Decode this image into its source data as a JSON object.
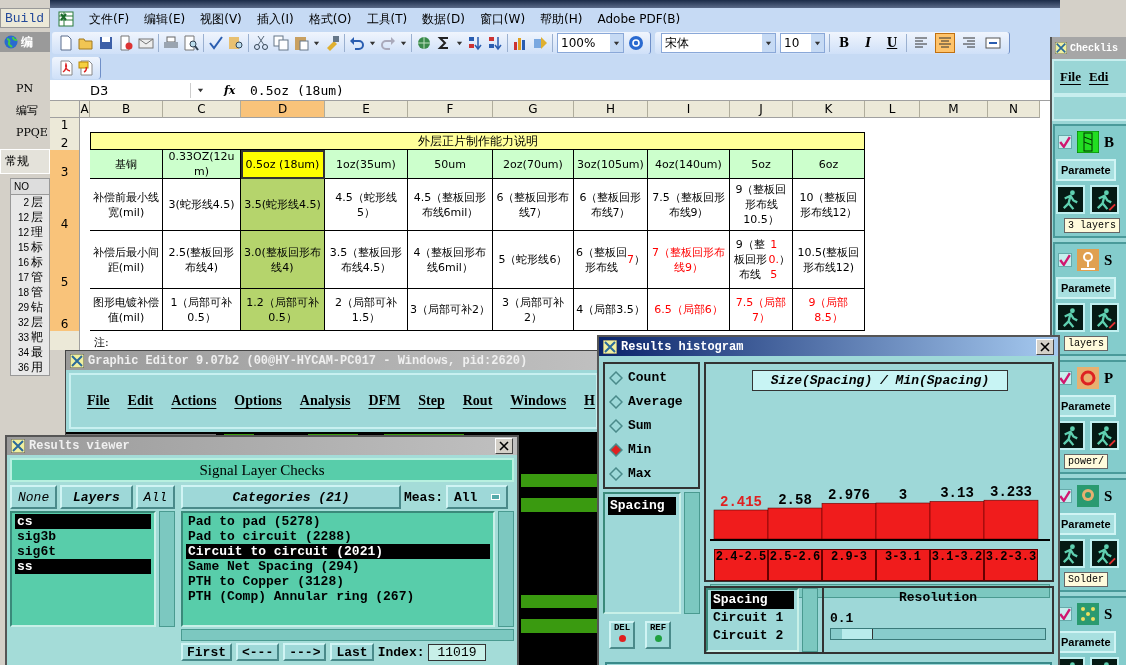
{
  "build_panel": {
    "top_button": "Build",
    "app_label": "编",
    "fields": [
      "PN",
      "编写",
      "PPQE"
    ],
    "tab": "常规",
    "list_header": "NO",
    "rows": [
      {
        "no": "2",
        "name": "层"
      },
      {
        "no": "12",
        "name": "层"
      },
      {
        "no": "12",
        "name": "理"
      },
      {
        "no": "15",
        "name": "标"
      },
      {
        "no": "16",
        "name": "标"
      },
      {
        "no": "17",
        "name": "管"
      },
      {
        "no": "18",
        "name": "管"
      },
      {
        "no": "29",
        "name": "钻"
      },
      {
        "no": "32",
        "name": "层"
      },
      {
        "no": "33",
        "name": "靶"
      },
      {
        "no": "34",
        "name": "最"
      },
      {
        "no": "36",
        "name": "用"
      }
    ]
  },
  "excel": {
    "menu": [
      "文件(F)",
      "编辑(E)",
      "视图(V)",
      "插入(I)",
      "格式(O)",
      "工具(T)",
      "数据(D)",
      "窗口(W)",
      "帮助(H)",
      "Adobe PDF(B)"
    ],
    "zoom": "100%",
    "font": "宋体",
    "font_size": "10",
    "format_buttons": [
      {
        "label": "B",
        "selected": false
      },
      {
        "label": "I",
        "selected": false
      },
      {
        "label": "U",
        "selected": false
      }
    ],
    "align_buttons": [
      {
        "selected": false
      },
      {
        "selected": true
      },
      {
        "selected": false
      },
      {
        "selected": false
      }
    ],
    "name_box": "D3",
    "fx_label": "fx",
    "formula": "0.5oz (18um)",
    "columns": [
      {
        "label": "A",
        "selected": false
      },
      {
        "label": "B",
        "selected": false
      },
      {
        "label": "C",
        "selected": false
      },
      {
        "label": "D",
        "selected": true
      },
      {
        "label": "E",
        "selected": false
      },
      {
        "label": "F",
        "selected": false
      },
      {
        "label": "G",
        "selected": false
      },
      {
        "label": "H",
        "selected": false
      },
      {
        "label": "I",
        "selected": false
      },
      {
        "label": "J",
        "selected": false
      },
      {
        "label": "K",
        "selected": false
      },
      {
        "label": "L",
        "selected": false
      },
      {
        "label": "M",
        "selected": false
      },
      {
        "label": "N",
        "selected": false
      }
    ],
    "rows": [
      {
        "label": "1",
        "selected": false
      },
      {
        "label": "2",
        "selected": false
      },
      {
        "label": "3",
        "selected": true
      },
      {
        "label": "4",
        "selected": true
      },
      {
        "label": "5",
        "selected": true
      },
      {
        "label": "6",
        "selected": true
      }
    ],
    "table_title": "外层正片制作能力说明",
    "table_rows": [
      [
        {
          "text": "基铜",
          "kind": "header",
          "red": false
        },
        {
          "text": "0.33OZ(12um)",
          "kind": "header",
          "red": false
        },
        {
          "text": "0.5oz (18um)",
          "kind": "mark",
          "red": false
        },
        {
          "text": "1oz(35um)",
          "kind": "header",
          "red": false
        },
        {
          "text": "50um",
          "kind": "header",
          "red": false
        },
        {
          "text": "2oz(70um)",
          "kind": "header",
          "red": false
        },
        {
          "text": "3oz(105um)",
          "kind": "header",
          "red": false
        },
        {
          "text": "4oz(140um)",
          "kind": "header",
          "red": false
        },
        {
          "text": "5oz",
          "kind": "header",
          "red": false
        },
        {
          "text": "6oz",
          "kind": "header",
          "red": false
        }
      ],
      [
        {
          "text": "补偿前最小线宽(mil)",
          "kind": "body",
          "red": false
        },
        {
          "text": "3(蛇形线4.5)",
          "kind": "body",
          "red": false
        },
        {
          "text": "3.5(蛇形线4.5)",
          "kind": "body",
          "red": false
        },
        {
          "text": "4.5（蛇形线5）",
          "kind": "body",
          "red": false
        },
        {
          "text": "4.5（整板回形布线6mil）",
          "kind": "body",
          "red": false
        },
        {
          "text": "6（整板回形布线7）",
          "kind": "body",
          "red": false
        },
        {
          "text": "6（整板回形布线7）",
          "kind": "body",
          "red": false
        },
        {
          "text": "7.5（整板回形布线9）",
          "kind": "body",
          "red": false
        },
        {
          "text": "9（整板回形布线10.5）",
          "kind": "body",
          "red": false
        },
        {
          "text": "10（整板回形布线12）",
          "kind": "body",
          "red": false
        }
      ],
      [
        {
          "text": "补偿后最小间距(mil)",
          "kind": "body",
          "red": false
        },
        {
          "text": "2.5(整板回形布线4)",
          "kind": "body",
          "red": false
        },
        {
          "text": "3.0(整板回形布线4)",
          "kind": "body",
          "red": false
        },
        {
          "text": "3.5（整板回形布线4.5）",
          "kind": "body",
          "red": false
        },
        {
          "text": "4（整板回形布线6mil）",
          "kind": "body",
          "red": false
        },
        {
          "text": "5（蛇形线6）",
          "kind": "body",
          "red": false
        },
        {
          "kind": "body",
          "parts": [
            {
              "text": "6（整板回形布线",
              "red": false
            },
            {
              "text": "7",
              "red": true
            },
            {
              "text": "）",
              "red": false
            }
          ]
        },
        {
          "text": "7（整板回形布线9）",
          "kind": "body",
          "red": true
        },
        {
          "kind": "body",
          "parts": [
            {
              "text": "9（整板回形布线",
              "red": false
            },
            {
              "text": "10.5",
              "red": true
            },
            {
              "text": "）",
              "red": false
            }
          ]
        },
        {
          "text": "10.5(整板回形布线12)",
          "kind": "body",
          "red": false
        }
      ],
      [
        {
          "text": "图形电镀补偿值(mil)",
          "kind": "body",
          "red": false
        },
        {
          "text": "1（局部可补0.5）",
          "kind": "body",
          "red": false
        },
        {
          "text": "1.2（局部可补0.5）",
          "kind": "body",
          "red": false
        },
        {
          "text": "2（局部可补1.5）",
          "kind": "body",
          "red": false
        },
        {
          "text": "3（局部可补2）",
          "kind": "body",
          "red": false
        },
        {
          "text": "3（局部可补2）",
          "kind": "body",
          "red": false
        },
        {
          "text": "4（局部3.5）",
          "kind": "body",
          "red": false
        },
        {
          "text": "6.5（局部6）",
          "kind": "body",
          "red": true
        },
        {
          "text": "7.5（局部7）",
          "kind": "body",
          "red": true
        },
        {
          "text": "9（局部8.5）",
          "kind": "body",
          "red": true
        }
      ]
    ],
    "note": "注:"
  },
  "checklist": {
    "title": "Checklis",
    "menu": [
      "File",
      "Edi"
    ],
    "items": [
      {
        "name": "B",
        "checked": true,
        "button": "Paramete",
        "desc": "3 layers"
      },
      {
        "name": "S",
        "checked": true,
        "button": "Paramete",
        "desc": "layers"
      },
      {
        "name": "P",
        "checked": true,
        "button": "Paramete",
        "desc": "power/"
      },
      {
        "name": "S",
        "checked": true,
        "button": "Paramete",
        "desc": "Solder"
      },
      {
        "name": "S",
        "checked": true,
        "button": "Paramete"
      }
    ]
  },
  "graphic_editor": {
    "title": "Graphic Editor 9.07b2 (00@HY-HYCAM-PC017 - Windows, pid:2620)",
    "menu": [
      "File",
      "Edit",
      "Actions",
      "Options",
      "Analysis",
      "DFM",
      "Step",
      "Rout",
      "Windows",
      "H"
    ]
  },
  "results_viewer": {
    "title": "Results viewer",
    "heading": "Signal Layer Checks",
    "layer_buttons": [
      "None",
      "Layers",
      "All"
    ],
    "categories_label": "Categories (21)",
    "meas_label": "Meas:",
    "meas_value": "All",
    "layers": [
      {
        "label": "cs",
        "selected": true
      },
      {
        "label": "sig3b",
        "selected": false
      },
      {
        "label": "sig6t",
        "selected": false
      },
      {
        "label": "ss",
        "selected": true
      }
    ],
    "categories": [
      {
        "label": "Pad to pad (5278)",
        "selected": false
      },
      {
        "label": "Pad to circuit (2288)",
        "selected": false
      },
      {
        "label": "Circuit to circuit (2021)",
        "selected": true
      },
      {
        "label": "Same Net Spacing (294)",
        "selected": false
      },
      {
        "label": "PTH to Copper (3128)",
        "selected": false
      },
      {
        "label": "PTH (Comp) Annular ring (267)",
        "selected": false
      }
    ],
    "nav_buttons": [
      "First",
      "<---",
      "--->",
      "Last"
    ],
    "index_label": "Index:",
    "index_value": "11019"
  },
  "histogram": {
    "title": "Results histogram",
    "modes": [
      {
        "label": "Count",
        "selected": false
      },
      {
        "label": "Average",
        "selected": false
      },
      {
        "label": "Sum",
        "selected": false
      },
      {
        "label": "Min",
        "selected": true
      },
      {
        "label": "Max",
        "selected": false
      }
    ],
    "measures": [
      {
        "label": "Spacing",
        "selected": true
      }
    ],
    "buttons": [
      "DEL",
      "REF"
    ],
    "chart_title": "Size(Spacing) / Min(Spacing)",
    "chart_data": {
      "type": "bar",
      "categories": [
        "2.4-2.5",
        "2.5-2.6",
        "2.9-3",
        "3-3.1",
        "3.1-3.2",
        "3.2-3.3"
      ],
      "values": [
        2.415,
        2.58,
        2.976,
        3,
        3.13,
        3.233
      ],
      "data_labels": true
    },
    "bins": [
      {
        "selected": true
      },
      {
        "selected": false
      },
      {
        "selected": false
      },
      {
        "selected": false
      },
      {
        "selected": false
      },
      {
        "selected": false
      }
    ],
    "series_list": [
      {
        "label": "Spacing",
        "selected": true
      },
      {
        "label": "Circuit 1",
        "selected": false
      },
      {
        "label": "Circuit 2",
        "selected": false
      }
    ],
    "resolution_label": "Resolution",
    "resolution": "0.1",
    "resolution_slider": {
      "level": 0.05
    }
  }
}
